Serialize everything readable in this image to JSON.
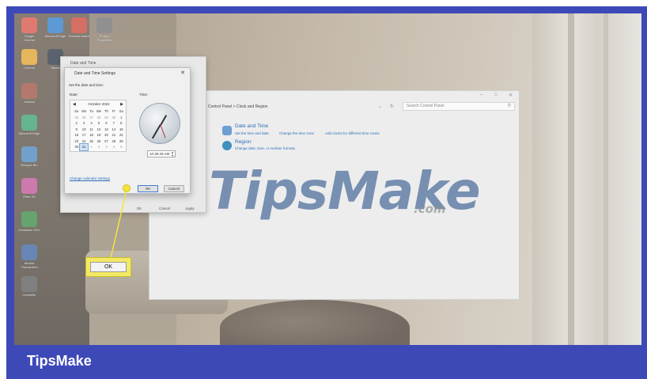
{
  "brand": {
    "footer_text": "TipsMake",
    "accent": "#3e49b8",
    "watermark": "TipsMake",
    "watermark_suffix": ".com"
  },
  "desktop_icons": [
    {
      "name": "Google Chrome",
      "color": "#e84c3d"
    },
    {
      "name": "Microsoft Edge",
      "color": "#1f7bd8"
    },
    {
      "name": "Podcast Addict",
      "color": "#d83b2b"
    },
    {
      "name": "Project Properties",
      "color": "#6e6e6e"
    },
    {
      "name": "Chrome",
      "color": "#f0a81c"
    },
    {
      "name": "Steam",
      "color": "#1b2838"
    },
    {
      "name": "Jessica",
      "color": "#a34b3a"
    },
    {
      "name": "Microsoft Edge",
      "color": "#2da66f"
    },
    {
      "name": "Recycle Bin",
      "color": "#3e86c8"
    },
    {
      "name": "Paint 3D",
      "color": "#c94b9c"
    },
    {
      "name": "Camtasia 2021",
      "color": "#2e8b3a"
    },
    {
      "name": "Mozilla Thunderbird",
      "color": "#2f5fa8"
    },
    {
      "name": "Controller",
      "color": "#555555"
    }
  ],
  "control_panel": {
    "breadcrumb": "Control Panel  >  Clock and Region",
    "search_placeholder": "Search Control Panel",
    "date_time": {
      "title": "Date and Time",
      "links": [
        "Set the time and date",
        "Change the time zone",
        "Add clocks for different time zones"
      ]
    },
    "region": {
      "title": "Region",
      "links": [
        "Change date, time, or number formats"
      ]
    }
  },
  "date_time_dialog": {
    "title": "Date and Time",
    "buttons": [
      "OK",
      "Cancel",
      "Apply"
    ]
  },
  "settings_dialog": {
    "title": "Date and Time Settings",
    "subtitle": "Set the date and time:",
    "date_label": "Date:",
    "time_label": "Time:",
    "calendar": {
      "month": "October 2022",
      "weekdays": [
        "Su",
        "Mo",
        "Tu",
        "We",
        "Th",
        "Fr",
        "Sa"
      ],
      "days": [
        "25",
        "26",
        "27",
        "28",
        "29",
        "30",
        "1",
        "2",
        "3",
        "4",
        "5",
        "6",
        "7",
        "8",
        "9",
        "10",
        "11",
        "12",
        "13",
        "14",
        "15",
        "16",
        "17",
        "18",
        "19",
        "20",
        "21",
        "22",
        "23",
        "24",
        "25",
        "26",
        "27",
        "28",
        "29",
        "30",
        "31",
        "1",
        "2",
        "3",
        "4",
        "5"
      ],
      "selected": "31"
    },
    "time_value": "10:35:26 AM",
    "calendar_link": "Change calendar settings",
    "ok_label": "OK",
    "cancel_label": "Cancel"
  },
  "callout": {
    "label": "OK",
    "color": "#f6e43a"
  }
}
